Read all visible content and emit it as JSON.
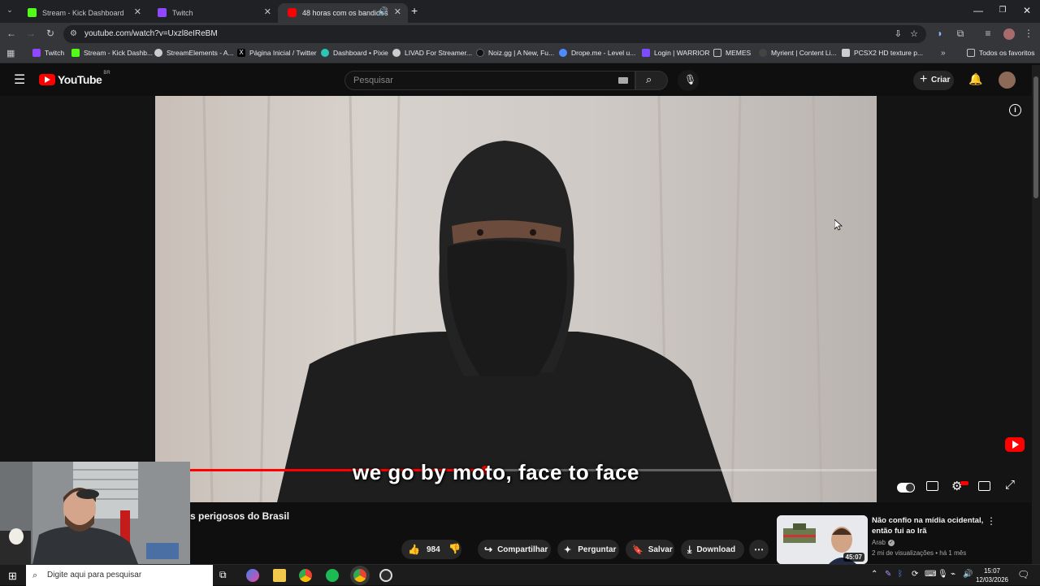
{
  "browser": {
    "tabs": [
      {
        "title": "Stream - Kick Dashboard",
        "color": "#53fc18"
      },
      {
        "title": "Twitch",
        "color": "#9146ff"
      },
      {
        "title": "48 horas com os bandidos",
        "color": "#ff0000"
      }
    ],
    "new_tab": "+",
    "url": "youtube.com/watch?v=Uxzl8eIReBM",
    "bookmarks": [
      {
        "label": "Twitch",
        "color": "#9146ff"
      },
      {
        "label": "Stream - Kick Dashb...",
        "color": "#53fc18"
      },
      {
        "label": "StreamElements - A...",
        "color": "#cccccc"
      },
      {
        "label": "Página Inicial / Twitter",
        "color": "#000000"
      },
      {
        "label": "Dashboard • Pixie",
        "color": "#2ec4b6"
      },
      {
        "label": "LIVAD For Streamer...",
        "color": "#cccccc"
      },
      {
        "label": "Noiz.gg | A New, Fu...",
        "color": "#111111"
      },
      {
        "label": "Drope.me - Level u...",
        "color": "#4f8cff"
      },
      {
        "label": "Login | WARRIOR",
        "color": "#7b4dff"
      },
      {
        "label": "MEMES",
        "color": "#cccccc"
      },
      {
        "label": "Myrient | Content Li...",
        "color": "#444444"
      },
      {
        "label": "PCSX2 HD texture p...",
        "color": "#cccccc"
      }
    ],
    "all_bookmarks": "Todos os favoritos"
  },
  "youtube": {
    "logo_text": "YouTube",
    "region": "BR",
    "search_placeholder": "Pesquisar",
    "create_label": "Criar"
  },
  "video": {
    "subtitle": "we go by moto, face to face",
    "progress_fraction": 0.43,
    "title_visible": "s perigosos do Brasil",
    "likes": "984",
    "share_label": "Compartilhar",
    "ask_label": "Perguntar",
    "save_label": "Salvar",
    "download_label": "Download"
  },
  "recommended": {
    "title_line1": "Não confio na mídia ocidental,",
    "title_line2": "então fui ao Irã",
    "channel": "Arab",
    "meta": "2 mi de visualizações • há 1 mês",
    "duration": "45:07"
  },
  "taskbar": {
    "search_placeholder": "Digite aqui para pesquisar",
    "time": "15:07",
    "date": "12/03/2026"
  }
}
